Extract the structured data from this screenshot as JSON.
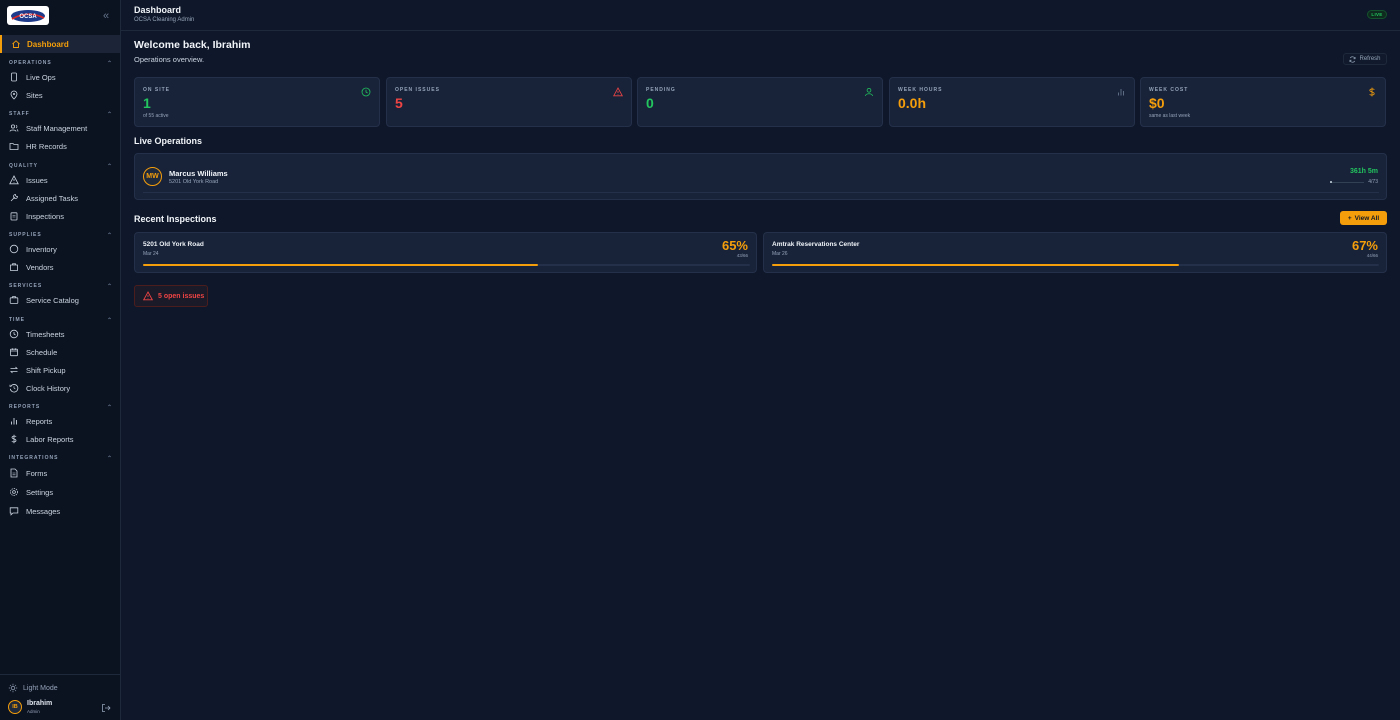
{
  "app": {
    "logo_text": "OCSA",
    "colors": {
      "accent": "#f59e0b",
      "success": "#22c55e",
      "danger": "#ef4444",
      "background": "#0f172a",
      "card": "#18233a"
    }
  },
  "sidebar": {
    "active": {
      "label": "Dashboard",
      "icon": "home-icon"
    },
    "sections": [
      {
        "title": "OPERATIONS",
        "items": [
          {
            "label": "Live Ops",
            "icon": "phone-icon"
          },
          {
            "label": "Sites",
            "icon": "map-pin-icon"
          }
        ]
      },
      {
        "title": "STAFF",
        "items": [
          {
            "label": "Staff Management",
            "icon": "users-icon"
          },
          {
            "label": "HR Records",
            "icon": "folder-icon"
          }
        ]
      },
      {
        "title": "QUALITY",
        "items": [
          {
            "label": "Issues",
            "icon": "warning-icon"
          },
          {
            "label": "Assigned Tasks",
            "icon": "wrench-icon"
          },
          {
            "label": "Inspections",
            "icon": "clipboard-icon"
          }
        ]
      },
      {
        "title": "SUPPLIES",
        "items": [
          {
            "label": "Inventory",
            "icon": "box-icon"
          },
          {
            "label": "Vendors",
            "icon": "store-icon"
          }
        ]
      },
      {
        "title": "SERVICES",
        "items": [
          {
            "label": "Service Catalog",
            "icon": "catalog-icon"
          }
        ]
      },
      {
        "title": "TIME",
        "items": [
          {
            "label": "Timesheets",
            "icon": "clock-icon"
          },
          {
            "label": "Schedule",
            "icon": "calendar-icon"
          },
          {
            "label": "Shift Pickup",
            "icon": "swap-icon"
          },
          {
            "label": "Clock History",
            "icon": "history-icon"
          }
        ]
      },
      {
        "title": "REPORTS",
        "items": [
          {
            "label": "Reports",
            "icon": "bar-chart-icon"
          },
          {
            "label": "Labor Reports",
            "icon": "dollar-icon"
          }
        ]
      },
      {
        "title": "INTEGRATIONS",
        "items": [
          {
            "label": "Forms",
            "icon": "document-icon"
          },
          {
            "label": "Settings",
            "icon": "gear-icon"
          },
          {
            "label": "Messages",
            "icon": "message-icon"
          }
        ]
      }
    ],
    "footer": {
      "light_mode_label": "Light Mode",
      "user_initials": "IB",
      "user_name": "Ibrahim",
      "user_role": "Admin"
    }
  },
  "header": {
    "title": "Dashboard",
    "subtitle": "OCSA Cleaning Admin",
    "live_badge": "LIVE"
  },
  "welcome": {
    "title": "Welcome back, Ibrahim",
    "subtitle": "Operations overview.",
    "refresh_label": "Refresh"
  },
  "stats": [
    {
      "label": "ON SITE",
      "value": "1",
      "sub": "of 55 active",
      "color": "#22c55e",
      "icon": "clock-icon"
    },
    {
      "label": "OPEN ISSUES",
      "value": "5",
      "sub": "",
      "color": "#ef4444",
      "icon": "warning-icon"
    },
    {
      "label": "PENDING",
      "value": "0",
      "sub": "",
      "color": "#22c55e",
      "icon": "user-icon"
    },
    {
      "label": "WEEK HOURS",
      "value": "0.0h",
      "sub": "",
      "color": "#f59e0b",
      "icon": "bar-chart-icon"
    },
    {
      "label": "WEEK COST",
      "value": "$0",
      "sub": "same as last week",
      "color": "#f59e0b",
      "icon": "dollar-icon"
    }
  ],
  "live_operations": {
    "title": "Live Operations",
    "entries": [
      {
        "initials": "MW",
        "name": "Marcus Williams",
        "address": "5201 Old York Road",
        "elapsed": "361h 5m",
        "progress": "4/73",
        "progress_fraction": 0.055
      }
    ]
  },
  "recent_inspections": {
    "title": "Recent Inspections",
    "view_all_label": "View All",
    "items": [
      {
        "site": "5201 Old York Road",
        "date": "Mar 24",
        "percent": "65%",
        "fraction": "43/66",
        "fill": 0.65
      },
      {
        "site": "Amtrak Reservations Center",
        "date": "Mar 26",
        "percent": "67%",
        "fraction": "44/66",
        "fill": 0.67
      }
    ]
  },
  "issues_banner": {
    "label": "5 open issues"
  }
}
